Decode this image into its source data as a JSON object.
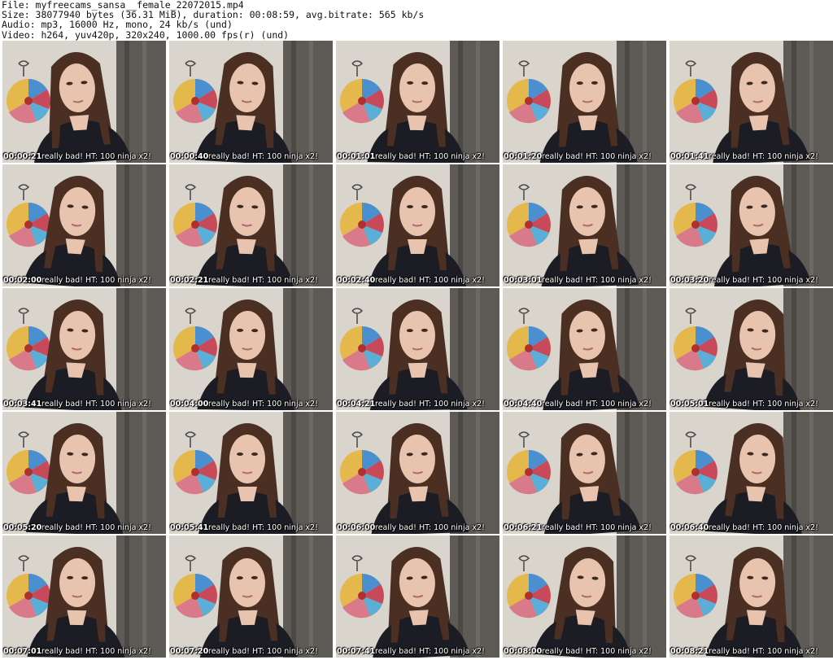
{
  "header": {
    "file": "File: myfreecams_sansa__female_22072015.mp4",
    "size": "Size: 38077940 bytes (36.31 MiB), duration: 00:08:59, avg.bitrate: 565 kb/s",
    "audio": "Audio: mp3, 16000 Hz, mono, 24 kb/s (und)",
    "video": "Video: h264, yuv420p, 320x240, 1000.00 fps(r) (und)"
  },
  "overlay_text": "really bad!   HT: 100 ninja x2!",
  "thumbnails": [
    {
      "timestamp": "00:00:21"
    },
    {
      "timestamp": "00:00:40"
    },
    {
      "timestamp": "00:01:01"
    },
    {
      "timestamp": "00:01:20"
    },
    {
      "timestamp": "00:01:41"
    },
    {
      "timestamp": "00:02:00"
    },
    {
      "timestamp": "00:02:21"
    },
    {
      "timestamp": "00:02:40"
    },
    {
      "timestamp": "00:03:01"
    },
    {
      "timestamp": "00:03:20"
    },
    {
      "timestamp": "00:03:41"
    },
    {
      "timestamp": "00:04:00"
    },
    {
      "timestamp": "00:04:21"
    },
    {
      "timestamp": "00:04:40"
    },
    {
      "timestamp": "00:05:01"
    },
    {
      "timestamp": "00:05:20"
    },
    {
      "timestamp": "00:05:41"
    },
    {
      "timestamp": "00:06:00"
    },
    {
      "timestamp": "00:06:21"
    },
    {
      "timestamp": "00:06:40"
    },
    {
      "timestamp": "00:07:01"
    },
    {
      "timestamp": "00:07:20"
    },
    {
      "timestamp": "00:07:41"
    },
    {
      "timestamp": "00:08:00"
    },
    {
      "timestamp": "00:08:21"
    }
  ],
  "colors": {
    "wall": "#d9d4cc",
    "curtain": "#5e5a55",
    "hair": "#4a2f22",
    "skin": "#e8c3ae",
    "shirt": "#1c1c24"
  }
}
